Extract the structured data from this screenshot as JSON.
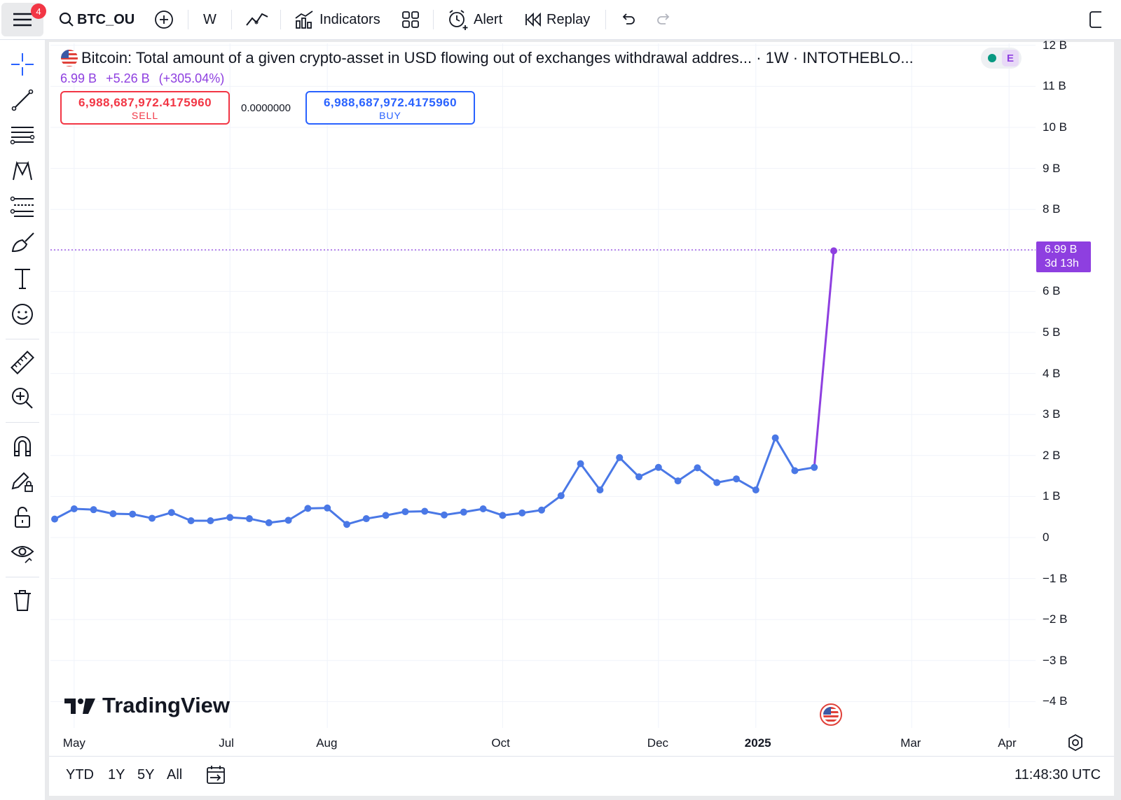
{
  "toolbar": {
    "notification_count": "4",
    "symbol": "BTC_OU",
    "interval": "W",
    "indicators_label": "Indicators",
    "alert_label": "Alert",
    "replay_label": "Replay"
  },
  "legend": {
    "title": "Bitcoin: Total amount of a given crypto-asset in USD flowing out of exchanges withdrawal addres... · 1W · INTOTHEBLO...",
    "last_value": "6.99 B",
    "change": "+5.26 B",
    "change_pct": "(+305.04%)",
    "sell_price": "6,988,687,972.4175960",
    "sell_label": "SELL",
    "spread": "0.0000000",
    "buy_price": "6,988,687,972.4175960",
    "buy_label": "BUY",
    "indicator_badge": "E"
  },
  "price_tag": {
    "value": "6.99 B",
    "countdown": "3d 13h"
  },
  "watermark": "TradingView",
  "bottom": {
    "ranges": [
      "YTD",
      "1Y",
      "5Y",
      "All"
    ],
    "time": "11:48:30 UTC"
  },
  "colors": {
    "series": "#4a78e6",
    "last_segment": "#8e3fe0",
    "sell": "#f23645",
    "buy": "#2962ff"
  },
  "chart_data": {
    "type": "line",
    "ylim": [
      -4.4,
      12
    ],
    "y_ticks": [
      "12 B",
      "11 B",
      "10 B",
      "9 B",
      "8 B",
      "6 B",
      "5 B",
      "4 B",
      "3 B",
      "2 B",
      "1 B",
      "0",
      "−1 B",
      "−2 B",
      "−3 B",
      "−4 B"
    ],
    "y_tick_values": [
      12,
      11,
      10,
      9,
      8,
      6,
      5,
      4,
      3,
      2,
      1,
      0,
      -1,
      -2,
      -3,
      -4
    ],
    "x_ticks": [
      "May",
      "Jul",
      "Aug",
      "Oct",
      "Dec",
      "2025",
      "Mar",
      "Apr"
    ],
    "x_tick_weeks": [
      1,
      9,
      14,
      23,
      31,
      36,
      44,
      49
    ],
    "x_week_index": [
      0,
      1,
      2,
      3,
      4,
      5,
      6,
      7,
      8,
      9,
      10,
      11,
      12,
      13,
      14,
      15,
      16,
      17,
      18,
      19,
      20,
      21,
      22,
      23,
      24,
      25,
      26,
      27,
      28,
      29,
      30,
      31,
      32,
      33,
      34,
      35,
      36,
      37,
      38,
      39,
      40
    ],
    "series": [
      {
        "values": [
          0.45,
          0.7,
          0.68,
          0.58,
          0.57,
          0.47,
          0.61,
          0.41,
          0.41,
          0.49,
          0.46,
          0.36,
          0.42,
          0.71,
          0.72,
          0.32,
          0.46,
          0.54,
          0.63,
          0.64,
          0.55,
          0.62,
          0.7,
          0.54,
          0.6,
          0.67,
          1.02,
          1.8,
          1.16,
          1.95,
          1.48,
          1.71,
          1.38,
          1.7,
          1.34,
          1.43,
          1.16,
          2.43,
          1.63,
          1.71,
          6.99
        ]
      }
    ]
  }
}
